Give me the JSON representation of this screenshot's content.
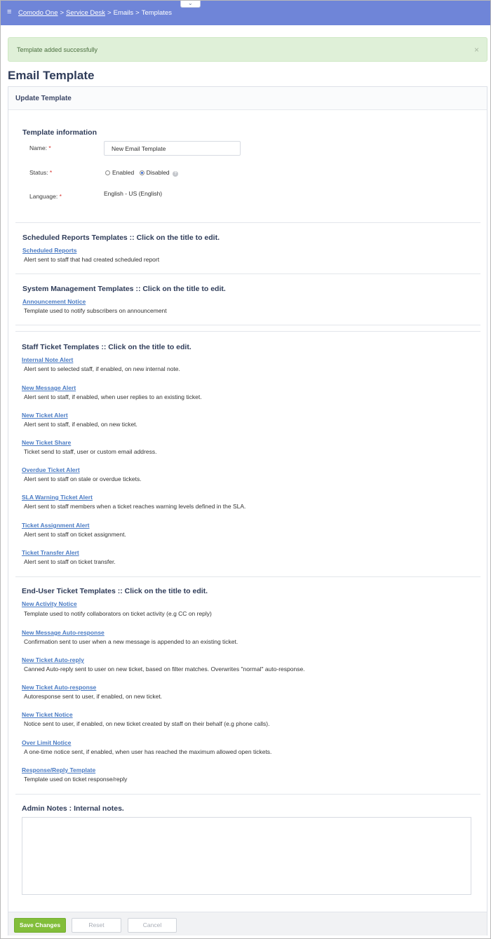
{
  "topbar": {
    "menu_glyph": "≡",
    "breadcrumb": [
      "Comodo One",
      "Service Desk",
      "Emails",
      "Templates"
    ],
    "separator": ">",
    "dropper_glyph": "⌄"
  },
  "alert": {
    "message": "Template added successfully",
    "close_glyph": "×"
  },
  "page_title": "Email Template",
  "card": {
    "header": "Update Template"
  },
  "template_info": {
    "title": "Template information",
    "name_label": "Name:",
    "name_value": "New Email Template",
    "status_label": "Status:",
    "status_options": [
      "Enabled",
      "Disabled"
    ],
    "status_selected": "Disabled",
    "help_glyph": "?",
    "language_label": "Language:",
    "language_value": "English - US (English)",
    "required_mark": "*"
  },
  "sections": {
    "scheduled": {
      "title": "Scheduled Reports Templates :: Click on the title to edit.",
      "items": [
        {
          "name": "Scheduled Reports",
          "desc": "Alert sent to staff that had created scheduled report"
        }
      ]
    },
    "system": {
      "title": "System Management Templates :: Click on the title to edit.",
      "items": [
        {
          "name": "Announcement Notice",
          "desc": "Template used to notify subscribers on announcement"
        }
      ]
    },
    "staff": {
      "title": "Staff Ticket Templates :: Click on the title to edit.",
      "items": [
        {
          "name": "Internal Note Alert",
          "desc": "Alert sent to selected staff, if enabled, on new internal note."
        },
        {
          "name": "New Message Alert",
          "desc": "Alert sent to staff, if enabled, when user replies to an existing ticket."
        },
        {
          "name": "New Ticket Alert",
          "desc": "Alert sent to staff, if enabled, on new ticket."
        },
        {
          "name": "New Ticket Share",
          "desc": "Ticket send to staff, user or custom email address."
        },
        {
          "name": "Overdue Ticket Alert",
          "desc": "Alert sent to staff on stale or overdue tickets."
        },
        {
          "name": "SLA Warning Ticket Alert",
          "desc": "Alert sent to staff members when a ticket reaches warning levels defined in the SLA."
        },
        {
          "name": "Ticket Assignment Alert",
          "desc": "Alert sent to staff on ticket assignment."
        },
        {
          "name": "Ticket Transfer Alert",
          "desc": "Alert sent to staff on ticket transfer."
        }
      ]
    },
    "enduser": {
      "title": "End-User Ticket Templates :: Click on the title to edit.",
      "items": [
        {
          "name": "New Activity Notice",
          "desc": "Template used to notify collaborators on ticket activity (e.g CC on reply)"
        },
        {
          "name": "New Message Auto-response",
          "desc": "Confirmation sent to user when a new message is appended to an existing ticket."
        },
        {
          "name": "New Ticket Auto-reply",
          "desc": "Canned Auto-reply sent to user on new ticket, based on filter matches. Overwrites \"normal\" auto-response."
        },
        {
          "name": "New Ticket Auto-response",
          "desc": "Autoresponse sent to user, if enabled, on new ticket."
        },
        {
          "name": "New Ticket Notice",
          "desc": "Notice sent to user, if enabled, on new ticket created by staff on their behalf (e.g phone calls)."
        },
        {
          "name": "Over Limit Notice",
          "desc": "A one-time notice sent, if enabled, when user has reached the maximum allowed open tickets."
        },
        {
          "name": "Response/Reply Template",
          "desc": "Template used on ticket response/reply"
        }
      ]
    }
  },
  "admin_notes": {
    "title": "Admin Notes : Internal notes.",
    "value": ""
  },
  "footer": {
    "save_label": "Save Changes",
    "reset_label": "Reset",
    "cancel_label": "Cancel"
  }
}
